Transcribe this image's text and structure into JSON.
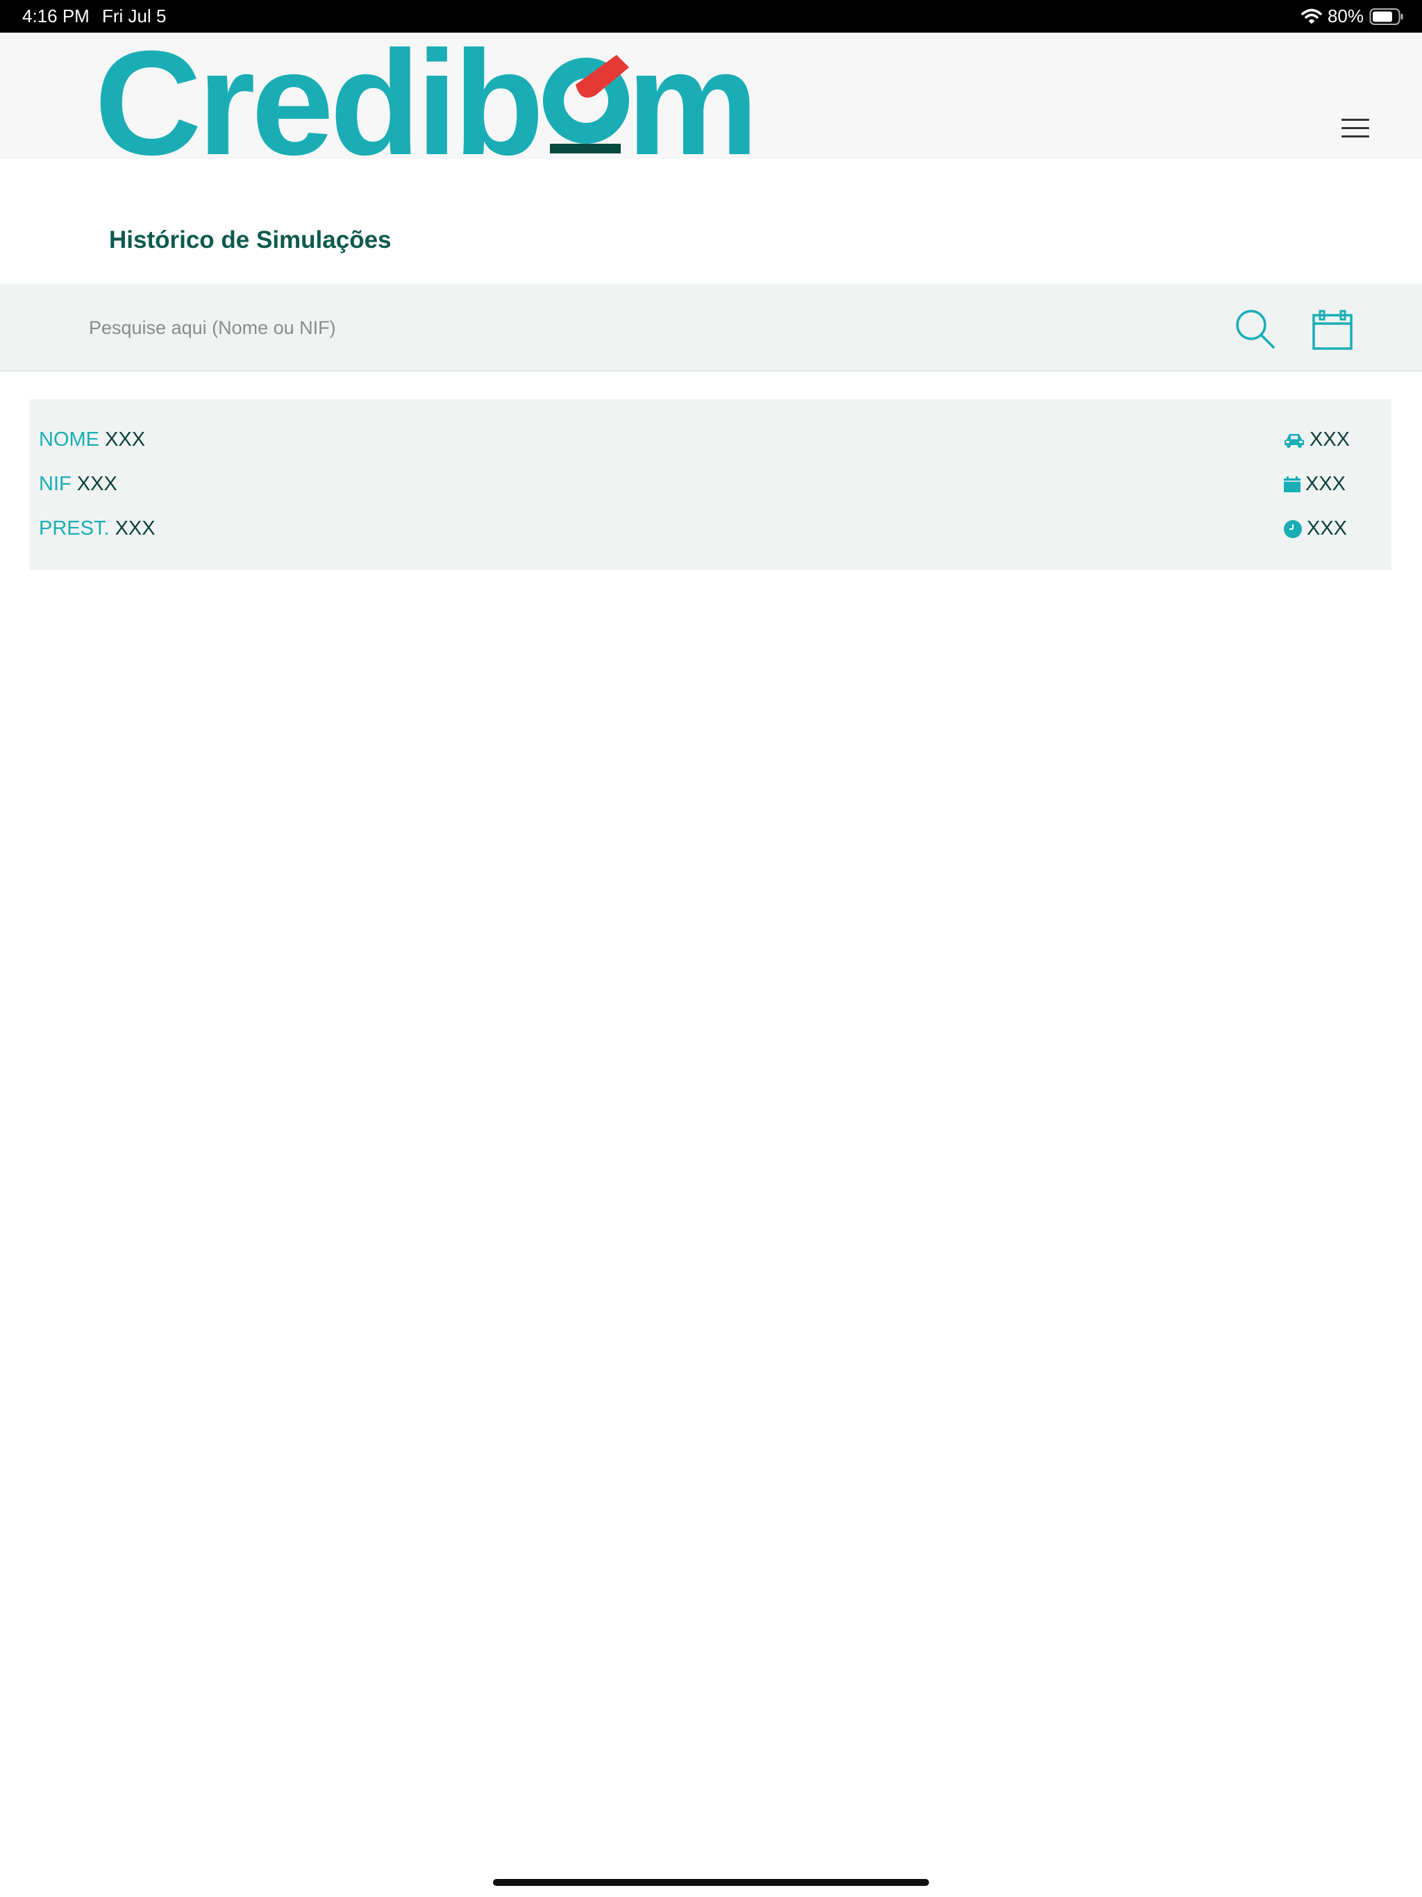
{
  "status_bar": {
    "time": "4:16 PM",
    "date": "Fri Jul 5",
    "battery": "80%",
    "battery_level": 0.8
  },
  "header": {
    "logo_text": "Credibom",
    "menu_icon": "hamburger-menu-icon"
  },
  "page": {
    "title": "Histórico de Simulações"
  },
  "search": {
    "placeholder": "Pesquise aqui (Nome ou NIF)",
    "value": "",
    "search_icon": "search-icon",
    "calendar_icon": "calendar-icon"
  },
  "results": [
    {
      "nome_label": "NOME",
      "nome_value": "XXX",
      "nif_label": "NIF",
      "nif_value": "XXX",
      "prest_label": "PREST.",
      "prest_value": "XXX",
      "vehicle_value": "XXX",
      "date_value": "XXX",
      "time_value": "XXX",
      "icons": [
        "car-icon",
        "calendar-small-icon",
        "clock-icon"
      ]
    }
  ],
  "colors": {
    "brand_teal": "#1aadb5",
    "dark_green": "#0d5a4d",
    "accent_red": "#e53935",
    "row_background": "#eff4f3"
  }
}
